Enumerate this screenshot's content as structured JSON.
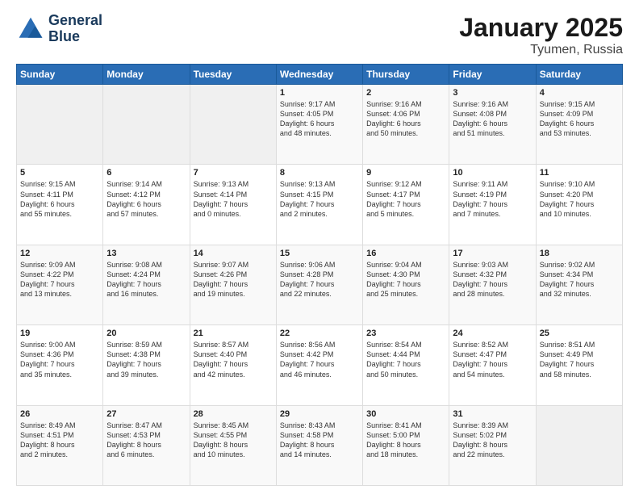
{
  "header": {
    "logo_line1": "General",
    "logo_line2": "Blue",
    "title": "January 2025",
    "subtitle": "Tyumen, Russia"
  },
  "columns": [
    "Sunday",
    "Monday",
    "Tuesday",
    "Wednesday",
    "Thursday",
    "Friday",
    "Saturday"
  ],
  "weeks": [
    [
      {
        "day": "",
        "content": ""
      },
      {
        "day": "",
        "content": ""
      },
      {
        "day": "",
        "content": ""
      },
      {
        "day": "1",
        "content": "Sunrise: 9:17 AM\nSunset: 4:05 PM\nDaylight: 6 hours\nand 48 minutes."
      },
      {
        "day": "2",
        "content": "Sunrise: 9:16 AM\nSunset: 4:06 PM\nDaylight: 6 hours\nand 50 minutes."
      },
      {
        "day": "3",
        "content": "Sunrise: 9:16 AM\nSunset: 4:08 PM\nDaylight: 6 hours\nand 51 minutes."
      },
      {
        "day": "4",
        "content": "Sunrise: 9:15 AM\nSunset: 4:09 PM\nDaylight: 6 hours\nand 53 minutes."
      }
    ],
    [
      {
        "day": "5",
        "content": "Sunrise: 9:15 AM\nSunset: 4:11 PM\nDaylight: 6 hours\nand 55 minutes."
      },
      {
        "day": "6",
        "content": "Sunrise: 9:14 AM\nSunset: 4:12 PM\nDaylight: 6 hours\nand 57 minutes."
      },
      {
        "day": "7",
        "content": "Sunrise: 9:13 AM\nSunset: 4:14 PM\nDaylight: 7 hours\nand 0 minutes."
      },
      {
        "day": "8",
        "content": "Sunrise: 9:13 AM\nSunset: 4:15 PM\nDaylight: 7 hours\nand 2 minutes."
      },
      {
        "day": "9",
        "content": "Sunrise: 9:12 AM\nSunset: 4:17 PM\nDaylight: 7 hours\nand 5 minutes."
      },
      {
        "day": "10",
        "content": "Sunrise: 9:11 AM\nSunset: 4:19 PM\nDaylight: 7 hours\nand 7 minutes."
      },
      {
        "day": "11",
        "content": "Sunrise: 9:10 AM\nSunset: 4:20 PM\nDaylight: 7 hours\nand 10 minutes."
      }
    ],
    [
      {
        "day": "12",
        "content": "Sunrise: 9:09 AM\nSunset: 4:22 PM\nDaylight: 7 hours\nand 13 minutes."
      },
      {
        "day": "13",
        "content": "Sunrise: 9:08 AM\nSunset: 4:24 PM\nDaylight: 7 hours\nand 16 minutes."
      },
      {
        "day": "14",
        "content": "Sunrise: 9:07 AM\nSunset: 4:26 PM\nDaylight: 7 hours\nand 19 minutes."
      },
      {
        "day": "15",
        "content": "Sunrise: 9:06 AM\nSunset: 4:28 PM\nDaylight: 7 hours\nand 22 minutes."
      },
      {
        "day": "16",
        "content": "Sunrise: 9:04 AM\nSunset: 4:30 PM\nDaylight: 7 hours\nand 25 minutes."
      },
      {
        "day": "17",
        "content": "Sunrise: 9:03 AM\nSunset: 4:32 PM\nDaylight: 7 hours\nand 28 minutes."
      },
      {
        "day": "18",
        "content": "Sunrise: 9:02 AM\nSunset: 4:34 PM\nDaylight: 7 hours\nand 32 minutes."
      }
    ],
    [
      {
        "day": "19",
        "content": "Sunrise: 9:00 AM\nSunset: 4:36 PM\nDaylight: 7 hours\nand 35 minutes."
      },
      {
        "day": "20",
        "content": "Sunrise: 8:59 AM\nSunset: 4:38 PM\nDaylight: 7 hours\nand 39 minutes."
      },
      {
        "day": "21",
        "content": "Sunrise: 8:57 AM\nSunset: 4:40 PM\nDaylight: 7 hours\nand 42 minutes."
      },
      {
        "day": "22",
        "content": "Sunrise: 8:56 AM\nSunset: 4:42 PM\nDaylight: 7 hours\nand 46 minutes."
      },
      {
        "day": "23",
        "content": "Sunrise: 8:54 AM\nSunset: 4:44 PM\nDaylight: 7 hours\nand 50 minutes."
      },
      {
        "day": "24",
        "content": "Sunrise: 8:52 AM\nSunset: 4:47 PM\nDaylight: 7 hours\nand 54 minutes."
      },
      {
        "day": "25",
        "content": "Sunrise: 8:51 AM\nSunset: 4:49 PM\nDaylight: 7 hours\nand 58 minutes."
      }
    ],
    [
      {
        "day": "26",
        "content": "Sunrise: 8:49 AM\nSunset: 4:51 PM\nDaylight: 8 hours\nand 2 minutes."
      },
      {
        "day": "27",
        "content": "Sunrise: 8:47 AM\nSunset: 4:53 PM\nDaylight: 8 hours\nand 6 minutes."
      },
      {
        "day": "28",
        "content": "Sunrise: 8:45 AM\nSunset: 4:55 PM\nDaylight: 8 hours\nand 10 minutes."
      },
      {
        "day": "29",
        "content": "Sunrise: 8:43 AM\nSunset: 4:58 PM\nDaylight: 8 hours\nand 14 minutes."
      },
      {
        "day": "30",
        "content": "Sunrise: 8:41 AM\nSunset: 5:00 PM\nDaylight: 8 hours\nand 18 minutes."
      },
      {
        "day": "31",
        "content": "Sunrise: 8:39 AM\nSunset: 5:02 PM\nDaylight: 8 hours\nand 22 minutes."
      },
      {
        "day": "",
        "content": ""
      }
    ]
  ]
}
